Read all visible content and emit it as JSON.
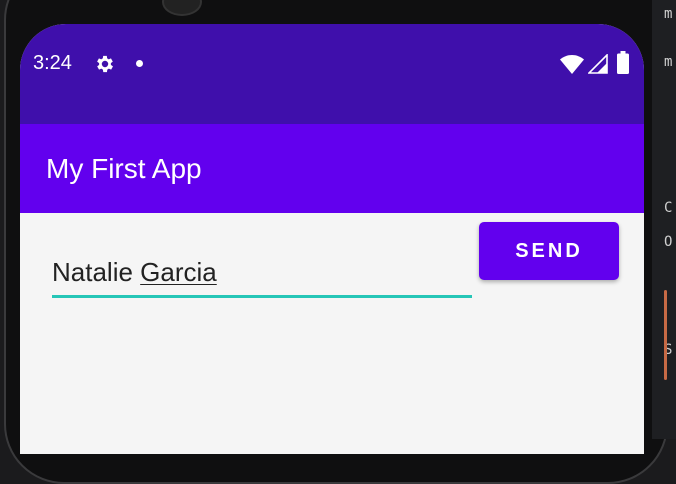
{
  "status_bar": {
    "time": "3:24",
    "icons": [
      "gear-icon",
      "notification-dot-icon",
      "wifi-icon",
      "signal-icon",
      "battery-icon"
    ],
    "color": "#3f0fab"
  },
  "app_bar": {
    "title": "My First App",
    "color": "#6200ee"
  },
  "message_input": {
    "value_first": "Natalie",
    "value_last": "Garcia",
    "accent_color": "#26c6b7"
  },
  "send_button": {
    "label": "SEND",
    "color": "#6200ee"
  },
  "side_strip_glyphs": [
    "m",
    "m",
    "C",
    "O",
    "S"
  ]
}
